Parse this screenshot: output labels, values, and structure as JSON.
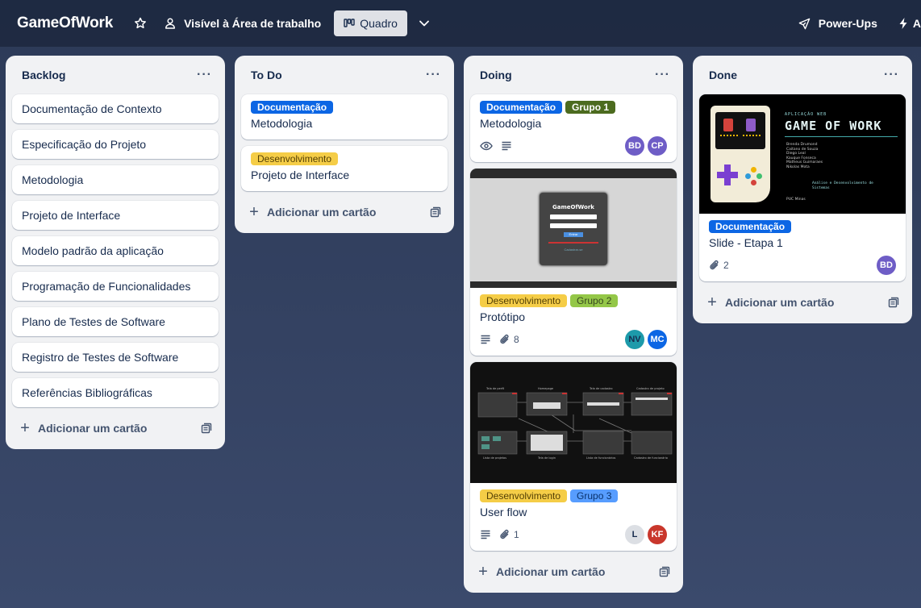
{
  "header": {
    "board_title": "GameOfWork",
    "visibility_label": "Visível à Área de trabalho",
    "view_label": "Quadro",
    "powerups_label": "Power-Ups",
    "automation_label": "A"
  },
  "lists": [
    {
      "title": "Backlog",
      "menu": "···",
      "add_label": "Adicionar um cartão",
      "cards": [
        {
          "title": "Documentação de Contexto"
        },
        {
          "title": "Especificação do Projeto"
        },
        {
          "title": "Metodologia"
        },
        {
          "title": "Projeto de Interface"
        },
        {
          "title": "Modelo padrão da aplicação"
        },
        {
          "title": "Programação de Funcionalidades"
        },
        {
          "title": "Plano de Testes de Software"
        },
        {
          "title": "Registro de Testes de Software"
        },
        {
          "title": "Referências Bibliográficas"
        }
      ]
    },
    {
      "title": "To Do",
      "menu": "···",
      "add_label": "Adicionar um cartão",
      "cards": [
        {
          "labels": [
            "Documentação"
          ],
          "title": "Metodologia"
        },
        {
          "labels": [
            "Desenvolvimento"
          ],
          "title": "Projeto de Interface"
        }
      ]
    },
    {
      "title": "Doing",
      "menu": "···",
      "add_label": "Adicionar um cartão",
      "cards": [
        {
          "labels": [
            "Documentação",
            "Grupo 1"
          ],
          "title": "Metodologia",
          "members": [
            "BD",
            "CP"
          ]
        },
        {
          "cover": {
            "app_title": "GameOfWork",
            "button": "Entrar",
            "link": "Cadastrar-se"
          },
          "labels": [
            "Desenvolvimento",
            "Grupo 2"
          ],
          "title": "Protótipo",
          "attachments": "8",
          "members": [
            "NV",
            "MC"
          ]
        },
        {
          "cover": {
            "labels": [
              "Tela de perfil",
              "Homepage",
              "Tela de cadastro",
              "Cadastro de projeto",
              "Lista de projetos",
              "Tela de login",
              "Lista de funcionários",
              "Cadastro de funcionário"
            ]
          },
          "labels": [
            "Desenvolvimento",
            "Grupo 3"
          ],
          "title": "User flow",
          "attachments": "1",
          "members": [
            "L",
            "KF"
          ]
        }
      ]
    },
    {
      "title": "Done",
      "menu": "···",
      "add_label": "Adicionar um cartão",
      "cards": [
        {
          "cover": {
            "subtitle": "APLICAÇÃO WEB",
            "title": "GAME OF WORK",
            "names": [
              "Brenda Drumond",
              "Caitano de Souza",
              "Diego Leal",
              "Kauque Fonseca",
              "Matheus Guimaraes",
              "Nikolas Mota"
            ],
            "course": "Análise e Desenvolvimento de Sistemas",
            "school": "PUC Minas"
          },
          "labels": [
            "Documentação"
          ],
          "title": "Slide - Etapa 1",
          "attachments": "2",
          "members": [
            "BD"
          ]
        }
      ]
    }
  ],
  "colors": {
    "label_blue": "#0c66e4",
    "label_yellow": "#f5cd47",
    "label_green": "#4c6b1f",
    "label_lime": "#94c748",
    "label_lightblue": "#579dff",
    "list_bg": "#f1f2f4"
  },
  "icons": [
    "star-icon",
    "people-icon",
    "board-icon",
    "chevron-down-icon",
    "rocket-icon",
    "lightning-icon",
    "eye-icon",
    "description-icon",
    "paperclip-icon",
    "plus-icon",
    "template-icon"
  ]
}
